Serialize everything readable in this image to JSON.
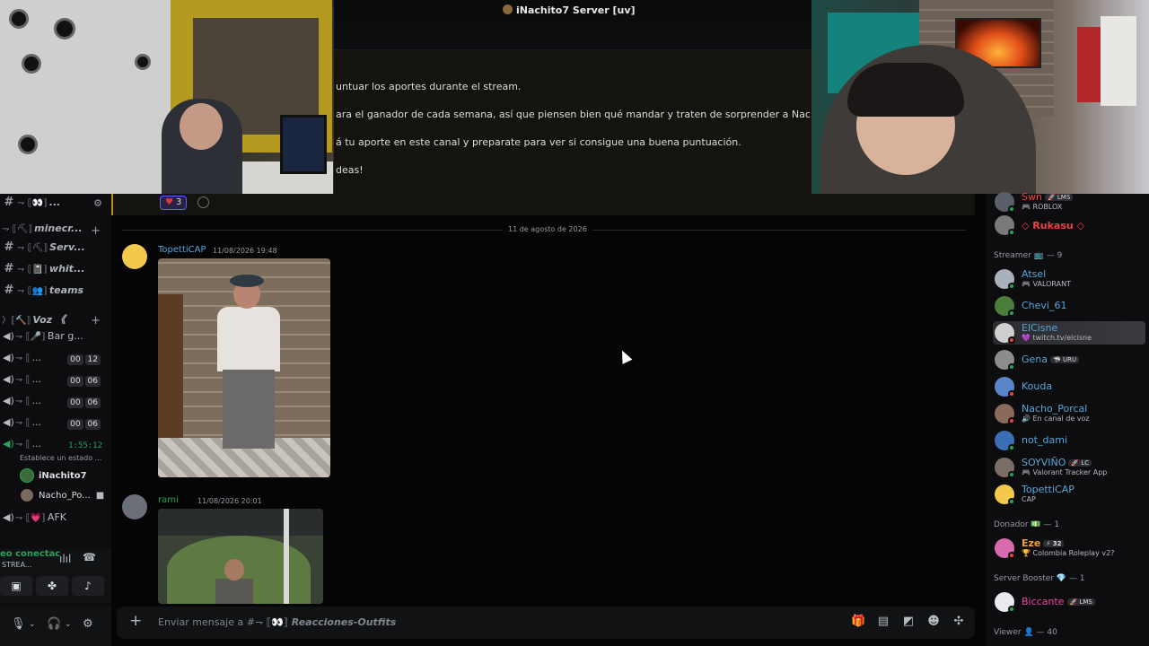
{
  "window": {
    "title": "iNachito7 Server [uv]"
  },
  "announcement": {
    "lines": [
      "untuar los aportes durante el stream.",
      "ara el ganador de cada semana, así que piensen bien qué mandar y traten de sorprender a Nachito. 😎",
      "á tu aporte en este canal y preparate para ver si consigue una buena puntuación.",
      "deas!"
    ],
    "reaction_count": "3"
  },
  "sidebar": {
    "channels": [
      {
        "prefix": "⇁ ⟦👀⟧",
        "label": "...",
        "type": "text"
      },
      {
        "prefix": "⇁ ⟦⛏⟧",
        "label": "minecr...",
        "type": "category"
      },
      {
        "prefix": "⇁ ⟦⛏⟧",
        "label": "Serv...",
        "type": "text"
      },
      {
        "prefix": "⇁ ⟦📓⟧",
        "label": "whit...",
        "type": "text"
      },
      {
        "prefix": "⇁ ⟦👥⟧",
        "label": "teams",
        "type": "text"
      },
      {
        "prefix": "〉⟦🔨⟧",
        "label": "Voz 《",
        "type": "category"
      }
    ],
    "voice_channels": [
      {
        "prefix": "⇁ ⟦🎤⟧",
        "label": "Bar g...",
        "a": "",
        "b": ""
      },
      {
        "prefix": "⇁ ⟦",
        "label": "...",
        "a": "00",
        "b": "12"
      },
      {
        "prefix": "⇁ ⟦",
        "label": "...",
        "a": "00",
        "b": "06"
      },
      {
        "prefix": "⇁ ⟦",
        "label": "...",
        "a": "00",
        "b": "06"
      },
      {
        "prefix": "⇁ ⟦",
        "label": "...",
        "a": "00",
        "b": "06"
      }
    ],
    "active_voice": {
      "prefix": "⇁ ⟦",
      "label": "...",
      "timer": "1:55:12"
    },
    "status_hint": "Establece un estado ...",
    "voice_users": [
      "iNachito7",
      "Nacho_Po..."
    ],
    "afk": {
      "prefix": "⇁ ⟦💗⟧",
      "label": "AFK"
    },
    "voice_panel": {
      "connected": "eo conectac",
      "channel": "STREA..."
    }
  },
  "divider": {
    "date": "11 de agosto de 2026"
  },
  "messages": [
    {
      "author": "TopettiCAP",
      "time": "11/08/2026 19:48",
      "color": "#58a6d9"
    },
    {
      "author": "rami",
      "time": "11/08/2026 20:01",
      "color": "#23a55a"
    }
  ],
  "composer": {
    "placeholder_prefix": "Enviar mensaje a #⇁ ⟦👀⟧",
    "placeholder_channel": "Reacciones-Outfits"
  },
  "members": {
    "top": [
      {
        "name": "Swn",
        "tag": "🚀 LMS",
        "activity": "🎮 ROBLOX",
        "color": "red"
      },
      {
        "name": "◇ Rukasu ◇",
        "tag": "",
        "activity": "",
        "color": "red"
      }
    ],
    "roles": [
      {
        "title": "Streamer 📺 — 9",
        "members": [
          {
            "name": "Atsel",
            "tag": "",
            "activity": "🎮 VALORANT",
            "color": "blue",
            "status": "online"
          },
          {
            "name": "Chevi_61",
            "tag": "",
            "activity": "",
            "color": "blue",
            "status": "online"
          },
          {
            "name": "ElCisne",
            "tag": "",
            "activity": "💜 twitch.tv/elcisne",
            "color": "blue",
            "status": "dnd",
            "highlight": true
          },
          {
            "name": "Gena",
            "tag": "🦈 URU",
            "activity": "",
            "color": "blue",
            "status": "online"
          },
          {
            "name": "Kouda",
            "tag": "",
            "activity": "",
            "color": "blue",
            "status": "dnd"
          },
          {
            "name": "Nacho_Porcal",
            "tag": "",
            "activity": "🔊 En canal de voz",
            "color": "blue",
            "status": "dnd"
          },
          {
            "name": "not_dami",
            "tag": "",
            "activity": "",
            "color": "blue",
            "status": "online"
          },
          {
            "name": "SOYVIÑO",
            "tag": "🚀 LC",
            "activity": "🎮 Valorant Tracker App",
            "color": "blue",
            "status": "online"
          },
          {
            "name": "TopettiCAP",
            "tag": "",
            "activity": "CAP",
            "color": "blue",
            "status": "online"
          }
        ]
      },
      {
        "title": "Donador 💵 — 1",
        "members": [
          {
            "name": "Eze",
            "tag": "⚡ 32",
            "activity": "🏆 Colombia Roleplay v2?",
            "color": "orange",
            "status": "dnd"
          }
        ]
      },
      {
        "title": "Server Booster 💎 — 1",
        "members": [
          {
            "name": "Biccante",
            "tag": "🚀 LMS",
            "activity": "",
            "color": "pink",
            "status": "online"
          }
        ]
      },
      {
        "title": "Viewer 👤 — 40",
        "members": []
      }
    ]
  }
}
